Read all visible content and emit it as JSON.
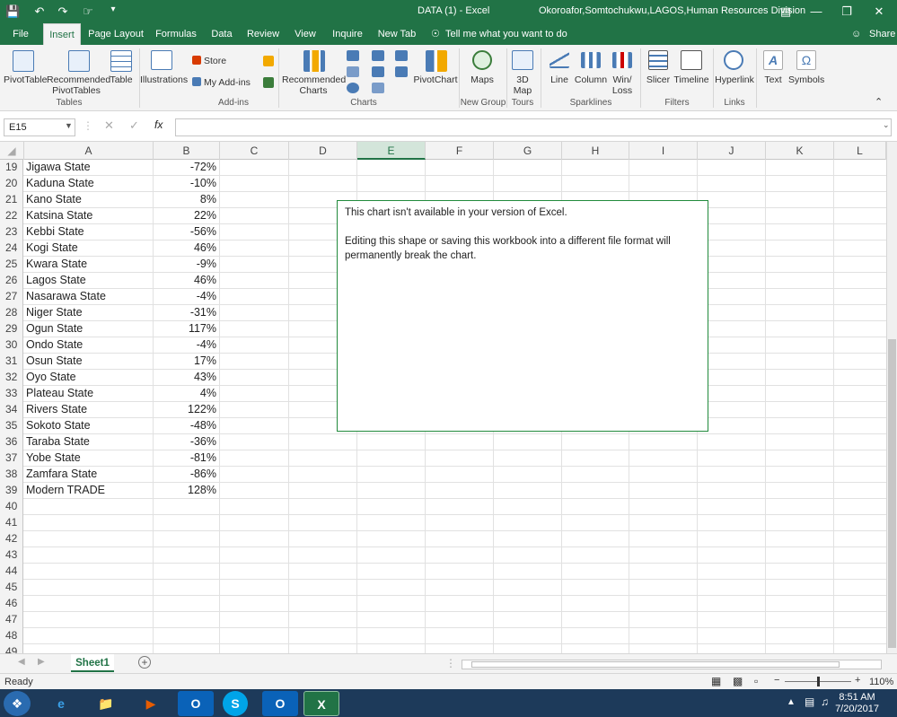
{
  "titlebar": {
    "title": "DATA (1)  -  Excel",
    "user": "Okoroafor,Somtochukwu,LAGOS,Human Resources Division",
    "share": "Share"
  },
  "tabs": [
    "File",
    "Insert",
    "Page Layout",
    "Formulas",
    "Data",
    "Review",
    "View",
    "Inquire",
    "New Tab"
  ],
  "tell_me": "Tell me what you want to do",
  "ribbon": {
    "pivottable": "PivotTable",
    "recommended_pivot": "Recommended",
    "recommended_pivot2": "PivotTables",
    "table": "Table",
    "illustrations": "Illustrations",
    "store": "Store",
    "my_addins": "My Add-ins",
    "rec_charts": "Recommended",
    "rec_charts2": "Charts",
    "pivotchart": "PivotChart",
    "maps": "Maps",
    "map3d": "3D",
    "map3d2": "Map",
    "line": "Line",
    "column": "Column",
    "winloss": "Win/",
    "winloss2": "Loss",
    "slicer": "Slicer",
    "timeline": "Timeline",
    "hyperlink": "Hyperlink",
    "text": "Text",
    "symbols": "Symbols",
    "groups": {
      "tables": "Tables",
      "addins": "Add-ins",
      "charts": "Charts",
      "newgroup": "New Group",
      "tours": "Tours",
      "sparklines": "Sparklines",
      "filters": "Filters",
      "links": "Links"
    }
  },
  "namebox": "E15",
  "columns": [
    "A",
    "B",
    "C",
    "D",
    "E",
    "F",
    "G",
    "H",
    "I",
    "J",
    "K",
    "L"
  ],
  "rows": [
    {
      "n": "19",
      "a": "Jigawa State",
      "b": "-72%"
    },
    {
      "n": "20",
      "a": "Kaduna State",
      "b": "-10%"
    },
    {
      "n": "21",
      "a": "Kano State",
      "b": "8%"
    },
    {
      "n": "22",
      "a": "Katsina State",
      "b": "22%"
    },
    {
      "n": "23",
      "a": "Kebbi State",
      "b": "-56%"
    },
    {
      "n": "24",
      "a": "Kogi State",
      "b": "46%"
    },
    {
      "n": "25",
      "a": "Kwara State",
      "b": "-9%"
    },
    {
      "n": "26",
      "a": "Lagos State",
      "b": "46%"
    },
    {
      "n": "27",
      "a": "Nasarawa State",
      "b": "-4%"
    },
    {
      "n": "28",
      "a": "Niger State",
      "b": "-31%"
    },
    {
      "n": "29",
      "a": "Ogun State",
      "b": "117%"
    },
    {
      "n": "30",
      "a": "Ondo State",
      "b": "-4%"
    },
    {
      "n": "31",
      "a": "Osun State",
      "b": "17%"
    },
    {
      "n": "32",
      "a": "Oyo State",
      "b": "43%"
    },
    {
      "n": "33",
      "a": "Plateau State",
      "b": "4%"
    },
    {
      "n": "34",
      "a": "Rivers State",
      "b": "122%"
    },
    {
      "n": "35",
      "a": "Sokoto State",
      "b": "-48%"
    },
    {
      "n": "36",
      "a": "Taraba State",
      "b": "-36%"
    },
    {
      "n": "37",
      "a": "Yobe State",
      "b": "-81%"
    },
    {
      "n": "38",
      "a": "Zamfara State",
      "b": "-86%"
    },
    {
      "n": "39",
      "a": "Modern TRADE",
      "b": "128%"
    },
    {
      "n": "40",
      "a": "",
      "b": ""
    },
    {
      "n": "41",
      "a": "",
      "b": ""
    },
    {
      "n": "42",
      "a": "",
      "b": ""
    },
    {
      "n": "43",
      "a": "",
      "b": ""
    },
    {
      "n": "44",
      "a": "",
      "b": ""
    },
    {
      "n": "45",
      "a": "",
      "b": ""
    },
    {
      "n": "46",
      "a": "",
      "b": ""
    },
    {
      "n": "47",
      "a": "",
      "b": ""
    },
    {
      "n": "48",
      "a": "",
      "b": ""
    },
    {
      "n": "49",
      "a": "",
      "b": ""
    }
  ],
  "chart_placeholder": {
    "line1": "This chart isn't available in your version of Excel.",
    "line2": "Editing this shape or saving this workbook into a different file format will permanently break the chart."
  },
  "sheet": "Sheet1",
  "status": {
    "ready": "Ready",
    "zoom": "110%"
  },
  "clock": {
    "time": "8:51 AM",
    "date": "7/20/2017"
  },
  "colors": {
    "excel_green": "#217346"
  }
}
